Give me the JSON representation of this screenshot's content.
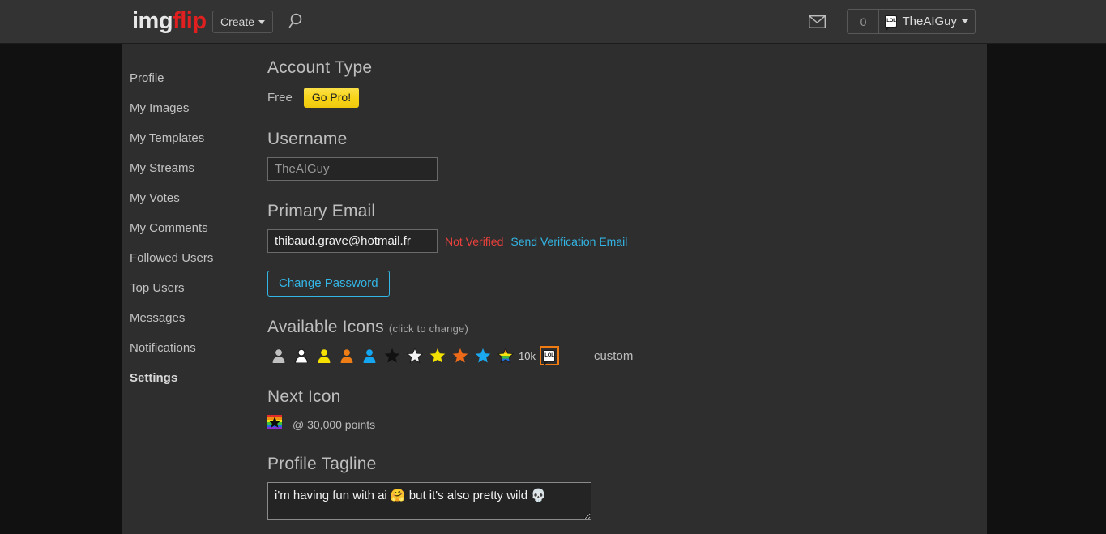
{
  "header": {
    "logo_img": "img",
    "logo_flip": "flip",
    "create_label": "Create",
    "search_icon": "search-icon",
    "envelope_icon": "envelope-icon",
    "message_count": "0",
    "username": "TheAIGuy",
    "user_badge_icon": "lol-badge-icon",
    "user_badge_text": "LOL"
  },
  "sidebar": {
    "items": [
      {
        "label": "Profile",
        "active": false
      },
      {
        "label": "My Images",
        "active": false
      },
      {
        "label": "My Templates",
        "active": false
      },
      {
        "label": "My Streams",
        "active": false
      },
      {
        "label": "My Votes",
        "active": false
      },
      {
        "label": "My Comments",
        "active": false
      },
      {
        "label": "Followed Users",
        "active": false
      },
      {
        "label": "Top Users",
        "active": false
      },
      {
        "label": "Messages",
        "active": false
      },
      {
        "label": "Notifications",
        "active": false
      },
      {
        "label": "Settings",
        "active": true
      }
    ]
  },
  "account_type": {
    "heading": "Account Type",
    "value": "Free",
    "cta_label": "Go Pro!"
  },
  "username_section": {
    "heading": "Username",
    "value": "TheAIGuy"
  },
  "email_section": {
    "heading": "Primary Email",
    "value": "thibaud.grave@hotmail.fr",
    "status": "Not Verified",
    "status_color": "#e8413c",
    "verify_link": "Send Verification Email",
    "link_color": "#33b5e5",
    "change_password_label": "Change Password"
  },
  "icons_section": {
    "heading": "Available Icons",
    "hint": "(click to change)",
    "icons": [
      {
        "name": "person-icon-grey",
        "kind": "person",
        "color": "#c0c0c0",
        "selected": false
      },
      {
        "name": "person-icon-white",
        "kind": "person",
        "color": "#ffffff",
        "selected": false
      },
      {
        "name": "person-icon-yellow",
        "kind": "person",
        "color": "#f5e000",
        "selected": false
      },
      {
        "name": "person-icon-orange",
        "kind": "person",
        "color": "#ef7d16",
        "selected": false
      },
      {
        "name": "person-icon-blue",
        "kind": "person",
        "color": "#14a6f0",
        "selected": false
      },
      {
        "name": "star-icon-black",
        "kind": "star",
        "color": "#111111",
        "selected": false
      },
      {
        "name": "star-icon-white",
        "kind": "star",
        "color": "#f2f2f2",
        "selected": false
      },
      {
        "name": "star-icon-yellow",
        "kind": "star",
        "color": "#f2e000",
        "selected": false
      },
      {
        "name": "star-icon-orange",
        "kind": "star",
        "color": "#ef6a18",
        "selected": false
      },
      {
        "name": "star-icon-blue",
        "kind": "star",
        "color": "#1aa8ef",
        "selected": false
      },
      {
        "name": "star-icon-rainbow",
        "kind": "star-rainbow",
        "color": "rainbow",
        "selected": false
      }
    ],
    "tenk_label": "10k",
    "selected_icon_name": "lol-badge-icon",
    "selected_icon_text": "LOL",
    "selection_color": "#f07b12",
    "custom_label": "custom"
  },
  "next_icon_section": {
    "heading": "Next Icon",
    "icon_name": "rainbow-star-square-icon",
    "requirement": "@ 30,000 points"
  },
  "tagline_section": {
    "heading": "Profile Tagline",
    "value": "i'm having fun with ai 🤗 but it's also pretty wild 💀"
  }
}
